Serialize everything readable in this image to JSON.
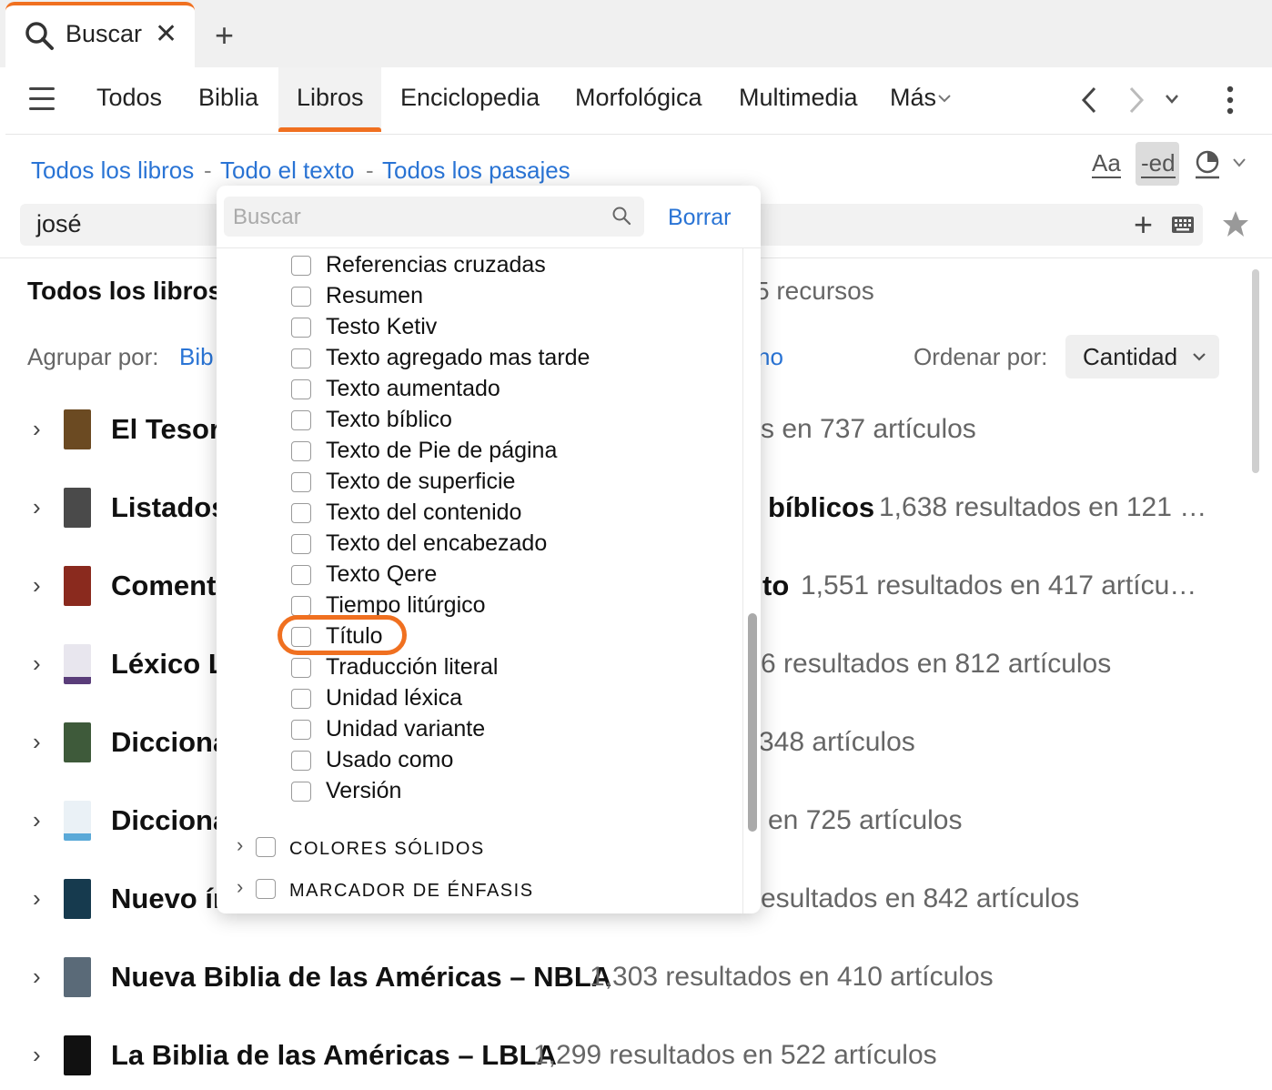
{
  "tab": {
    "label": "Buscar"
  },
  "nav": {
    "tabs": [
      "Todos",
      "Biblia",
      "Libros",
      "Enciclopedia",
      "Morfológica",
      "Multimedia"
    ],
    "more": "Más",
    "active": "Libros"
  },
  "breadcrumb": [
    "Todos los libros",
    "Todo el texto",
    "Todos los pasajes"
  ],
  "toolbar": {
    "font_label": "Aa",
    "ed_label": "-ed"
  },
  "search": {
    "query": "josé"
  },
  "results": {
    "title": "Todos los libros",
    "count_fragment": "5 recursos",
    "group_label": "Agrupar por:",
    "group_value_fragment": "Bib",
    "group_value_fragment_right": "no",
    "sort_label": "Ordenar por:",
    "sort_value": "Cantidad",
    "rows": [
      {
        "title": "El Tesoro",
        "right_bold": "",
        "right": "s en 737 artículos"
      },
      {
        "title": "Listados",
        "right_bold": "bíblicos",
        "right": "1,638 resultados en 121 …"
      },
      {
        "title": "Comenta",
        "right_bold": "to",
        "right": "1,551 resultados en 417 artícu…"
      },
      {
        "title": "Léxico Le",
        "right_bold": "",
        "right": "6 resultados en 812 artículos"
      },
      {
        "title": "Dicciona",
        "right_bold": "",
        "right": "348 artículos"
      },
      {
        "title": "Dicciona",
        "right_bold": "",
        "right": "en 725 artículos"
      },
      {
        "title": "Nuevo ín",
        "right_bold": "",
        "right": "esultados en 842 artículos"
      },
      {
        "title": "Nueva Biblia de las Américas – NBLA",
        "right_bold": "",
        "right": "1,303 resultados en 410 artículos"
      },
      {
        "title": "La Biblia de las Américas – LBLA",
        "right_bold": "",
        "right": "1,299 resultados en 522 artículos"
      }
    ]
  },
  "dropdown": {
    "search_placeholder": "Buscar",
    "clear_label": "Borrar",
    "options": [
      "Referencias cruzadas",
      "Resumen",
      "Testo Ketiv",
      "Texto agregado mas tarde",
      "Texto aumentado",
      "Texto bíblico",
      "Texto de Pie de página",
      "Texto de superficie",
      "Texto del contenido",
      "Texto del encabezado",
      "Texto Qere",
      "Tiempo litúrgico",
      "Título",
      "Traducción literal",
      "Unidad léxica",
      "Unidad variante",
      "Usado como",
      "Versión"
    ],
    "highlighted_option": "Título",
    "groups": [
      "COLORES SÓLIDOS",
      "MARCADOR DE ÉNFASIS"
    ]
  },
  "colors": {
    "accent": "#f07020",
    "link": "#2a74d5"
  }
}
